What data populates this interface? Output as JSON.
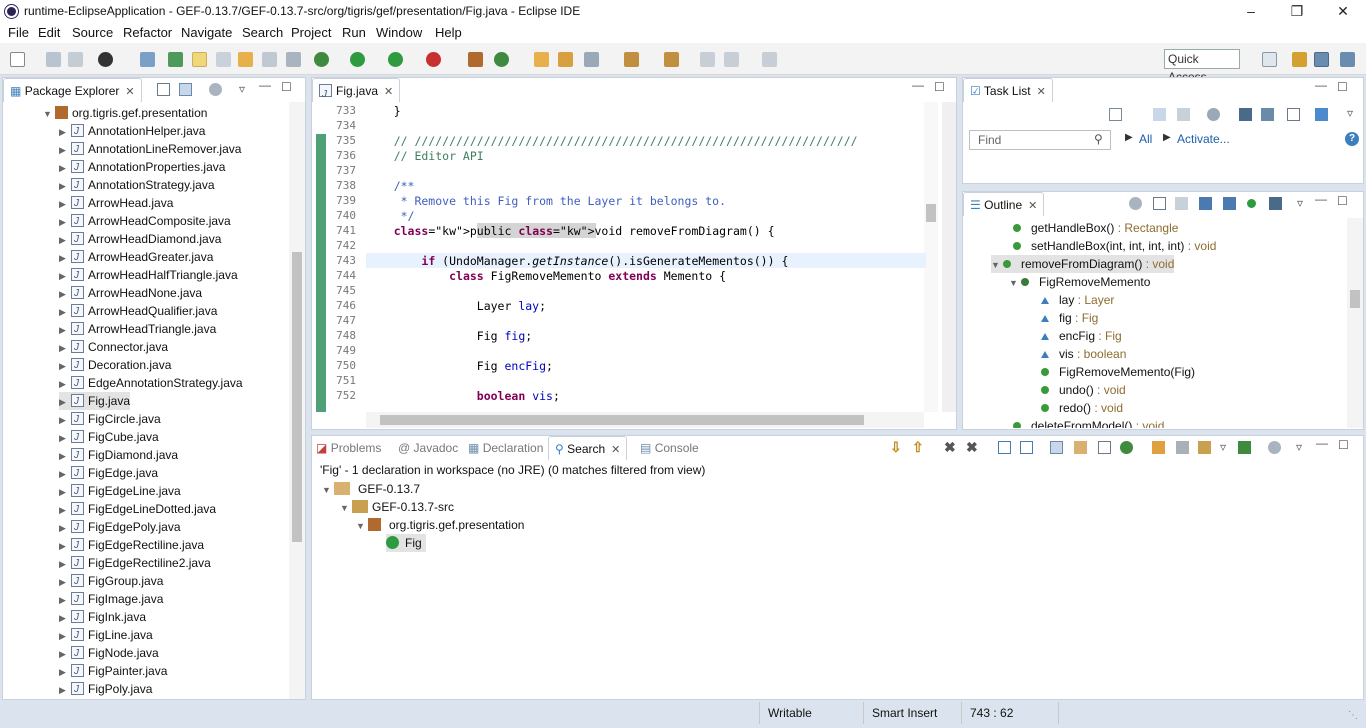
{
  "window": {
    "title": "runtime-EclipseApplication - GEF-0.13.7/GEF-0.13.7-src/org/tigris/gef/presentation/Fig.java - Eclipse IDE"
  },
  "menu": [
    "File",
    "Edit",
    "Source",
    "Refactor",
    "Navigate",
    "Search",
    "Project",
    "Run",
    "Window",
    "Help"
  ],
  "toolbar": {
    "quick_access": "Quick Access"
  },
  "package_explorer": {
    "tab": "Package Explorer",
    "package": "org.tigris.gef.presentation",
    "files": [
      "AnnotationHelper.java",
      "AnnotationLineRemover.java",
      "AnnotationProperties.java",
      "AnnotationStrategy.java",
      "ArrowHead.java",
      "ArrowHeadComposite.java",
      "ArrowHeadDiamond.java",
      "ArrowHeadGreater.java",
      "ArrowHeadHalfTriangle.java",
      "ArrowHeadNone.java",
      "ArrowHeadQualifier.java",
      "ArrowHeadTriangle.java",
      "Connector.java",
      "Decoration.java",
      "EdgeAnnotationStrategy.java",
      "Fig.java",
      "FigCircle.java",
      "FigCube.java",
      "FigDiamond.java",
      "FigEdge.java",
      "FigEdgeLine.java",
      "FigEdgeLineDotted.java",
      "FigEdgePoly.java",
      "FigEdgeRectiline.java",
      "FigEdgeRectiline2.java",
      "FigGroup.java",
      "FigImage.java",
      "FigInk.java",
      "FigLine.java",
      "FigNode.java",
      "FigPainter.java",
      "FigPoly.java"
    ],
    "selected": "Fig.java"
  },
  "editor": {
    "tab": "Fig.java",
    "lines": [
      {
        "n": "733",
        "text": "    }"
      },
      {
        "n": "734",
        "text": ""
      },
      {
        "n": "735",
        "text": "    // ////////////////////////////////////////////////////////////////"
      },
      {
        "n": "736",
        "text": "    // Editor API"
      },
      {
        "n": "737",
        "text": ""
      },
      {
        "n": "738",
        "text": "    /**"
      },
      {
        "n": "739",
        "text": "     * Remove this Fig from the Layer it belongs to."
      },
      {
        "n": "740",
        "text": "     */"
      },
      {
        "n": "741",
        "text": "    public void removeFromDiagram() {"
      },
      {
        "n": "742",
        "text": ""
      },
      {
        "n": "743",
        "text": "        if (UndoManager.getInstance().isGenerateMementos()) {"
      },
      {
        "n": "744",
        "text": "            class FigRemoveMemento extends Memento {"
      },
      {
        "n": "745",
        "text": ""
      },
      {
        "n": "746",
        "text": "                Layer lay;"
      },
      {
        "n": "747",
        "text": ""
      },
      {
        "n": "748",
        "text": "                Fig fig;"
      },
      {
        "n": "749",
        "text": ""
      },
      {
        "n": "750",
        "text": "                Fig encFig;"
      },
      {
        "n": "751",
        "text": ""
      },
      {
        "n": "752",
        "text": "                boolean vis;"
      }
    ]
  },
  "task_list": {
    "tab": "Task List",
    "find_placeholder": "Find",
    "all": "All",
    "activate": "Activate..."
  },
  "outline": {
    "tab": "Outline",
    "items": [
      {
        "name": "getHandleBox()",
        "type": " : Rectangle"
      },
      {
        "name": "setHandleBox(int, int, int, int)",
        "type": " : void"
      },
      {
        "name": "removeFromDiagram()",
        "type": " : void"
      },
      {
        "name": "FigRemoveMemento",
        "type": ""
      },
      {
        "name": "lay",
        "type": " : Layer"
      },
      {
        "name": "fig",
        "type": " : Fig"
      },
      {
        "name": "encFig",
        "type": " : Fig"
      },
      {
        "name": "vis",
        "type": " : boolean"
      },
      {
        "name": "FigRemoveMemento(Fig)",
        "type": ""
      },
      {
        "name": "undo()",
        "type": " : void"
      },
      {
        "name": "redo()",
        "type": " : void"
      },
      {
        "name": "deleteFromModel()",
        "type": " : void"
      }
    ]
  },
  "bottom": {
    "tabs": [
      "Problems",
      "Javadoc",
      "Declaration",
      "Search",
      "Console"
    ],
    "active": "Search",
    "summary": "'Fig' - 1 declaration in workspace (no JRE) (0 matches filtered from view)",
    "tree": [
      "GEF-0.13.7",
      "GEF-0.13.7-src",
      "org.tigris.gef.presentation",
      "Fig"
    ]
  },
  "status": {
    "writable": "Writable",
    "insert": "Smart Insert",
    "position": "743 : 62"
  },
  "colors": {
    "accent": "#3c7fbf",
    "keyword": "#7f0055",
    "comment": "#3f5fbf",
    "selection": "#e3e3e3"
  }
}
